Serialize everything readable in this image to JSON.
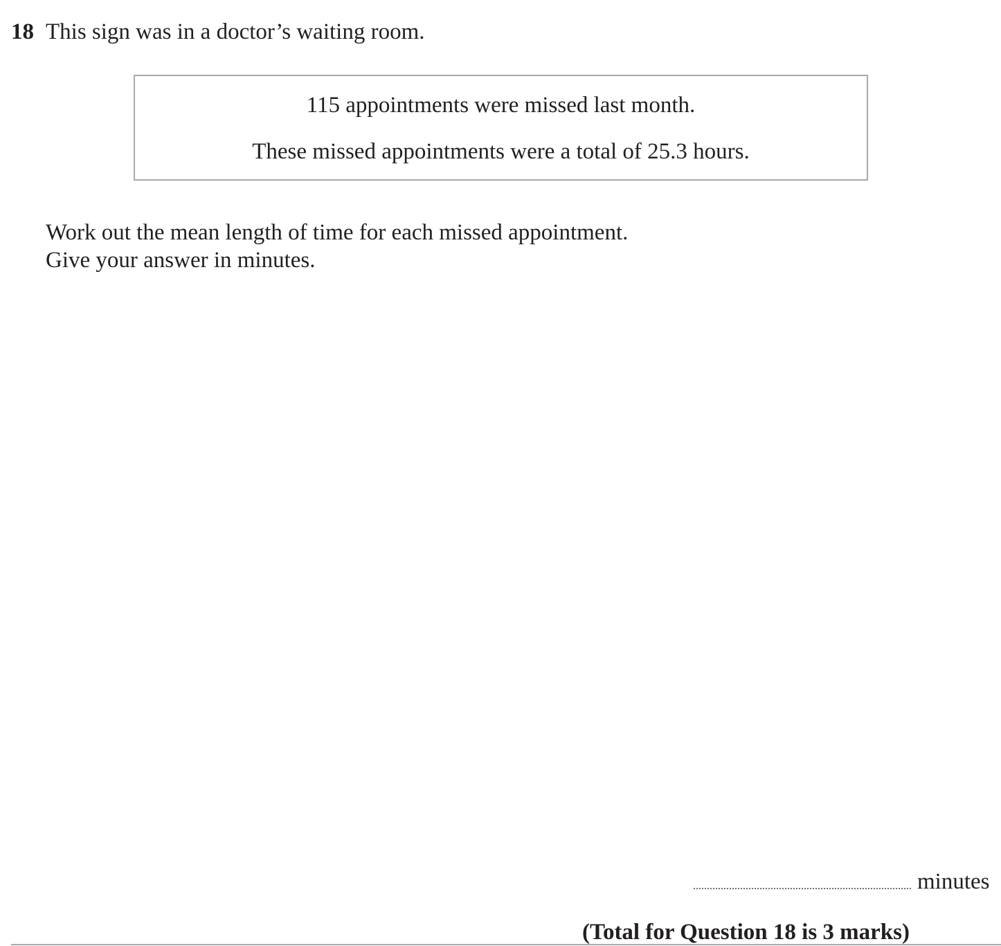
{
  "question": {
    "number": "18",
    "intro": "This sign was in a doctor’s waiting room."
  },
  "sign": {
    "line1": "115 appointments were missed last month.",
    "line2": "These missed appointments were a total of 25.3 hours."
  },
  "instructions": {
    "line1": "Work out the mean length of time for each missed appointment.",
    "line2": "Give your answer in minutes."
  },
  "answer": {
    "unit": "minutes"
  },
  "total": {
    "text": "(Total for Question 18 is 3 marks)"
  }
}
